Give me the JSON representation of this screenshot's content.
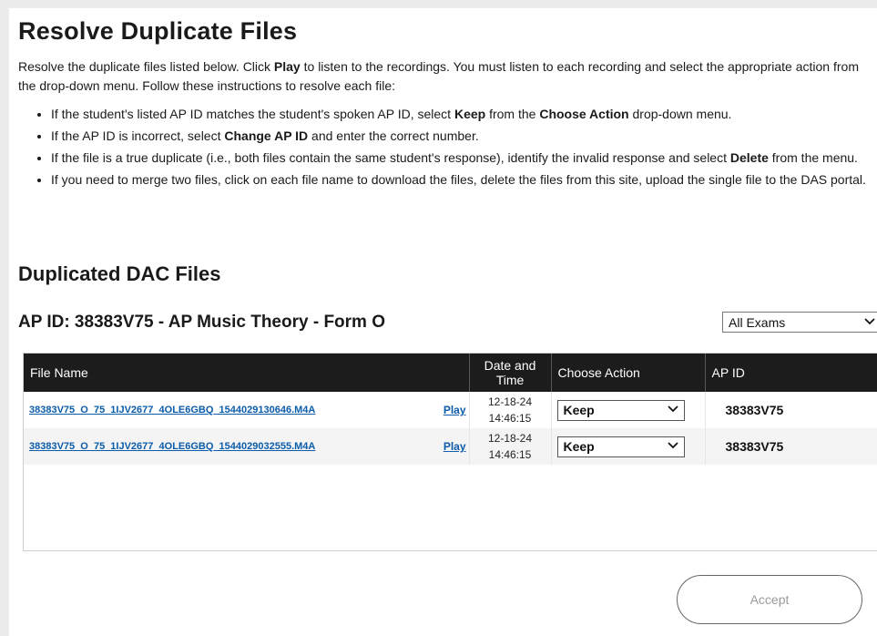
{
  "page": {
    "title": "Resolve Duplicate Files",
    "intro_text": "Resolve the duplicate files listed below. Click Play to listen to the recordings. You must listen to each recording and select the appropriate action from the drop-down menu. Follow these instructions to resolve each file:",
    "instructions": [
      "If the student's listed AP ID matches the student's spoken AP ID, select Keep from the Choose Action drop-down menu.",
      "If the AP ID is incorrect, select Change AP ID and enter the correct number.",
      "If the file is a true duplicate (i.e., both files contain the same student's response), identify the invalid response and select Delete from the menu.",
      "If you need to merge two files, click on each file name to download the files, delete the files from this site, upload the single file to the DAS portal."
    ]
  },
  "section": {
    "title": "Duplicated DAC Files",
    "exam_heading": "AP ID: 38383V75 - AP Music Theory - Form O",
    "exam_filter": {
      "selected": "All Exams"
    }
  },
  "table": {
    "columns": [
      "File Name",
      "Date and Time",
      "Choose Action",
      "AP ID"
    ],
    "rows": [
      {
        "file_name": "38383V75_O_75_1IJV2677_4OLE6GBQ_1544029130646.M4A",
        "play": "Play",
        "date": "12-18-24",
        "time": "14:46:15",
        "action": "Keep",
        "ap_id": "38383V75"
      },
      {
        "file_name": "38383V75_O_75_1IJV2677_4OLE6GBQ_1544029032555.M4A",
        "play": "Play",
        "date": "12-18-24",
        "time": "14:46:15",
        "action": "Keep",
        "ap_id": "38383V75"
      }
    ]
  },
  "footer": {
    "accept_label": "Accept"
  },
  "icons": {
    "dropdown": "chevron-down-icon"
  }
}
